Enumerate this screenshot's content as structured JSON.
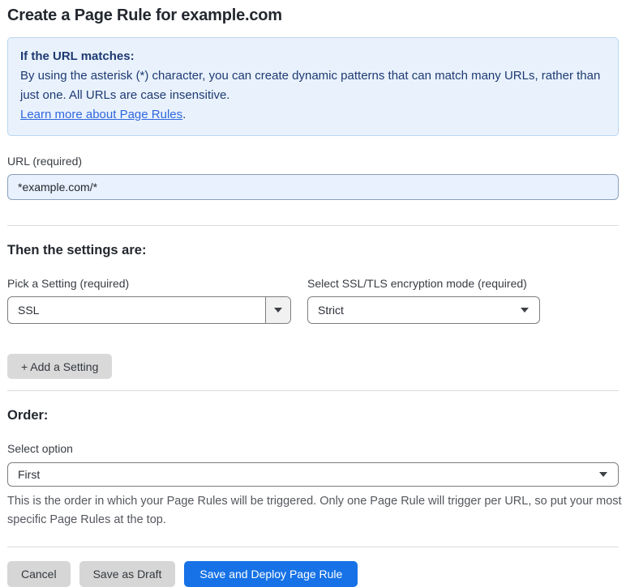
{
  "page": {
    "title": "Create a Page Rule for example.com"
  },
  "info_box": {
    "heading": "If the URL matches:",
    "body": "By using the asterisk (*) character, you can create dynamic patterns that can match many URLs, rather than just one. All URLs are case insensitive.",
    "link_label": "Learn more about Page Rules",
    "link_suffix": "."
  },
  "url_field": {
    "label": "URL (required)",
    "value": "*example.com/*"
  },
  "settings_section": {
    "heading": "Then the settings are:",
    "setting_select": {
      "label": "Pick a Setting (required)",
      "value": "SSL"
    },
    "mode_select": {
      "label": "Select SSL/TLS encryption mode (required)",
      "value": "Strict"
    },
    "add_setting_label": "+ Add a Setting"
  },
  "order_section": {
    "heading": "Order:",
    "select_label": "Select option",
    "select_value": "First",
    "help_text": "This is the order in which your Page Rules will be triggered. Only one Page Rule will trigger per URL, so put your most specific Page Rules at the top."
  },
  "footer": {
    "cancel_label": "Cancel",
    "save_draft_label": "Save as Draft",
    "save_deploy_label": "Save and Deploy Page Rule"
  },
  "colors": {
    "accent_blue": "#1672e6",
    "info_bg": "#e9f2fc",
    "info_border": "#b8d6f1",
    "info_text": "#1e3a73",
    "link_blue": "#2f67de",
    "input_bg": "#e8f1fd"
  }
}
